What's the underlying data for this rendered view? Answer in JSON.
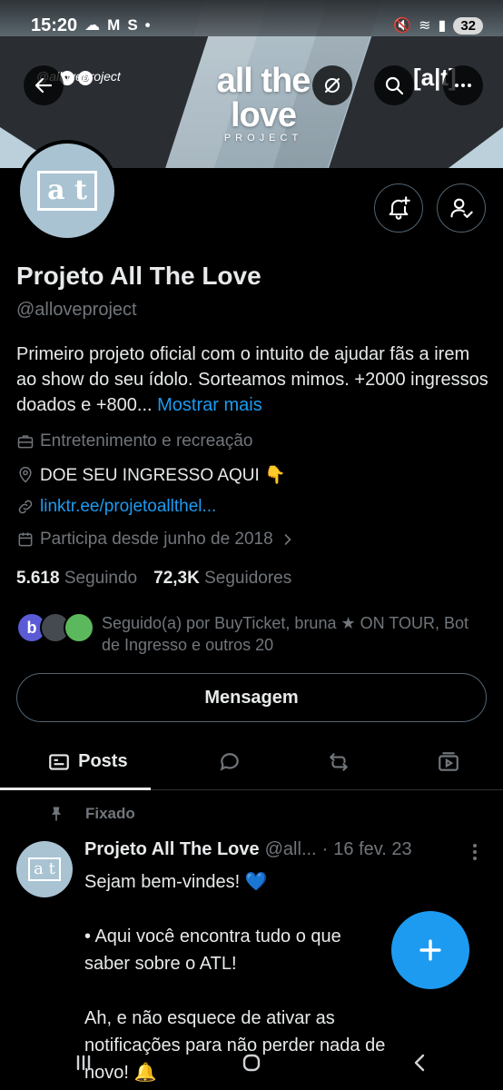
{
  "status_bar": {
    "time": "15:20",
    "left_icons": [
      "weather-icon",
      "mail-icon",
      "s-app-icon",
      "dot-icon"
    ],
    "battery": "32"
  },
  "banner": {
    "handle": "@alloveproject",
    "logo_main": "all the love",
    "logo_sub": "PROJECT",
    "mark": "[a|t]"
  },
  "avatar": {
    "mark": "a t"
  },
  "profile": {
    "name": "Projeto All The Love",
    "handle": "@alloveproject",
    "bio": "Primeiro projeto oficial com o intuito de ajudar fãs a irem ao show do seu ídolo. Sorteamos mimos. +2000 ingressos doados e +800...",
    "bio_more": "Mostrar mais",
    "category": "Entretenimento e recreação",
    "location": "DOE SEU INGRESSO AQUI 👇",
    "link": "linktr.ee/projetoallthel...",
    "joined": "Participa desde junho de 2018"
  },
  "stats": {
    "following_count": "5.618",
    "following_label": "Seguindo",
    "followers_count": "72,3K",
    "followers_label": "Seguidores"
  },
  "followed_by": {
    "text": "Seguido(a) por BuyTicket, bruna ★ ON TOUR, Bot de Ingresso e outros 20",
    "avatars": [
      {
        "letter": "b",
        "color": "#5b5bd6"
      },
      {
        "letter": "",
        "color": "#444a50"
      },
      {
        "letter": "",
        "color": "#5cb85c"
      }
    ]
  },
  "message_button": "Mensagem",
  "tabs": [
    {
      "label": "Posts",
      "icon": "posts-icon",
      "active": true
    },
    {
      "label": "",
      "icon": "reply-icon",
      "active": false
    },
    {
      "label": "",
      "icon": "retweet-icon",
      "active": false
    },
    {
      "label": "",
      "icon": "media-icon",
      "active": false
    }
  ],
  "pinned_post": {
    "pinned_label": "Fixado",
    "author": "Projeto All The Love",
    "handle": "@all...",
    "separator": "·",
    "date": "16 fev. 23",
    "text": "Sejam bem-vindes! 💙\n\n•  Aqui você encontra tudo o que\nsaber sobre o ATL!\n\nAh, e não esquece de ativar as\nnotificações para não perder nada de\nnovo! 🔔"
  },
  "colors": {
    "accent": "#1d9bf0",
    "background": "#000000",
    "muted": "#71767b",
    "avatar_bg": "#a9c3d2"
  }
}
